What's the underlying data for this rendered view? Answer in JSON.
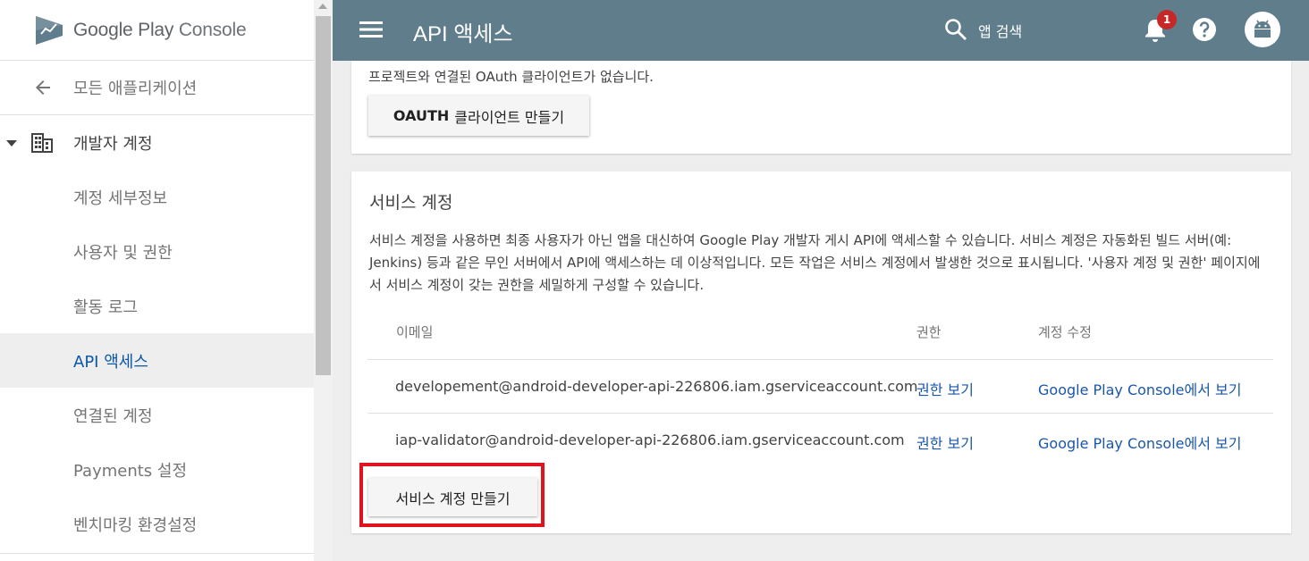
{
  "app": {
    "logo_text_a": "Google Play",
    "logo_text_b": " Console"
  },
  "header": {
    "title": "API 액세스",
    "search_label": "앱 검색",
    "notification_count": "1"
  },
  "sidebar": {
    "back_label": "모든 애플리케이션",
    "group_label": "개발자 계정",
    "items": [
      {
        "label": "계정 세부정보"
      },
      {
        "label": "사용자 및 권한"
      },
      {
        "label": "활동 로그"
      },
      {
        "label": "API 액세스"
      },
      {
        "label": "연결된 계정"
      },
      {
        "label": "Payments 설정"
      },
      {
        "label": "벤치마킹 환경설정"
      }
    ],
    "active_index": 3
  },
  "oauth": {
    "message": "프로젝트와 연결된 OAuth 클라이언트가 없습니다.",
    "button_bold": "OAUTH",
    "button_rest": "클라이언트 만들기"
  },
  "service_accounts": {
    "title": "서비스 계정",
    "description": "서비스 계정을 사용하면 최종 사용자가 아닌 앱을 대신하여 Google Play 개발자 게시 API에 액세스할 수 있습니다. 서비스 계정은 자동화된 빌드 서버(예: Jenkins) 등과 같은 무인 서버에서 API에 액세스하는 데 이상적입니다. 모든 작업은 서비스 계정에서 발생한 것으로 표시됩니다. '사용자 계정 및 권한' 페이지에서 서비스 계정이 갖는 권한을 세밀하게 구성할 수 있습니다.",
    "columns": [
      "이메일",
      "권한",
      "계정 수정"
    ],
    "rows": [
      {
        "email": "developement@android-developer-api-226806.iam.gserviceaccount.com",
        "permission_link": "권한 보기",
        "edit_link": "Google Play Console에서 보기"
      },
      {
        "email": "iap-validator@android-developer-api-226806.iam.gserviceaccount.com",
        "permission_link": "권한 보기",
        "edit_link": "Google Play Console에서 보기"
      }
    ],
    "create_button": "서비스 계정 만들기"
  },
  "colors": {
    "header_bg": "#607d8b",
    "link": "#1a57a8",
    "active_nav": "#0d57a8",
    "highlight": "#e0141e",
    "badge": "#c62828"
  },
  "icons": [
    "play-console-logo",
    "back-arrow-icon",
    "caret-down-icon",
    "building-icon",
    "menu-icon",
    "search-icon",
    "bell-icon",
    "help-icon",
    "android-avatar-icon"
  ]
}
